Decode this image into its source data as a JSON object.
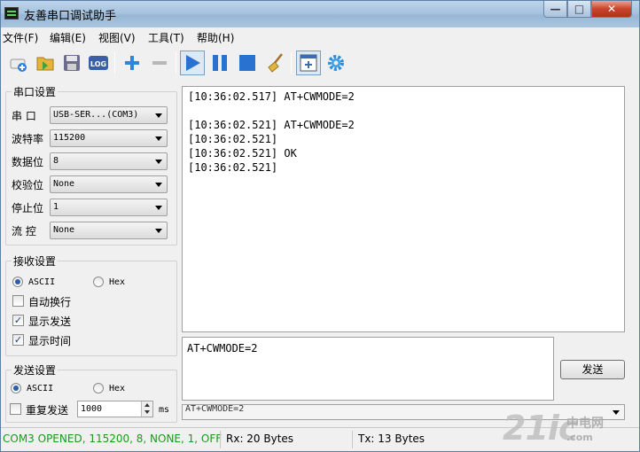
{
  "window": {
    "title": "友善串口调试助手",
    "buttons": {
      "minimize": "—",
      "maximize": "□",
      "close": "✕"
    }
  },
  "menu": [
    {
      "label": "文件(F)"
    },
    {
      "label": "编辑(E)"
    },
    {
      "label": "视图(V)"
    },
    {
      "label": "工具(T)"
    },
    {
      "label": "帮助(H)"
    }
  ],
  "toolbar": {
    "log_icon_text": "LOG",
    "items": [
      "new-connection",
      "open-folder",
      "save",
      "log",
      "add",
      "remove",
      "start",
      "pause",
      "stop",
      "clear",
      "new-window",
      "settings"
    ]
  },
  "serial_settings": {
    "title": "串口设置",
    "port": {
      "label": "串  口",
      "value": "USB-SER...(COM3)"
    },
    "baud": {
      "label": "波特率",
      "value": "115200"
    },
    "databits": {
      "label": "数据位",
      "value": "8"
    },
    "parity": {
      "label": "校验位",
      "value": "None"
    },
    "stopbits": {
      "label": "停止位",
      "value": "1"
    },
    "flow": {
      "label": "流  控",
      "value": "None"
    }
  },
  "receive_settings": {
    "title": "接收设置",
    "ascii": "ASCII",
    "hex": "Hex",
    "mode": "ASCII",
    "auto_newline": {
      "label": "自动换行",
      "checked": false
    },
    "show_sent": {
      "label": "显示发送",
      "checked": true
    },
    "show_time": {
      "label": "显示时间",
      "checked": true
    }
  },
  "send_settings": {
    "title": "发送设置",
    "ascii": "ASCII",
    "hex": "Hex",
    "mode": "ASCII",
    "repeat": {
      "label": "重复发送",
      "checked": false
    },
    "interval": "1000",
    "unit": "ms"
  },
  "receive_log": [
    "[10:36:02.517] AT+CWMODE=2",
    "",
    "[10:36:02.521] AT+CWMODE=2",
    "[10:36:02.521]",
    "[10:36:02.521] OK",
    "[10:36:02.521]"
  ],
  "send": {
    "text": "AT+CWMODE=2",
    "button": "发送",
    "history_value": "AT+CWMODE=2"
  },
  "status": {
    "port_state": "COM3 OPENED, 115200, 8, NONE, 1, OFF",
    "rx": "Rx: 20 Bytes",
    "tx": "Tx: 13 Bytes",
    "port_state_color": "#1a9a1a"
  },
  "watermark": {
    "big": "21ic",
    "small": "中电网",
    "url": ".com"
  }
}
